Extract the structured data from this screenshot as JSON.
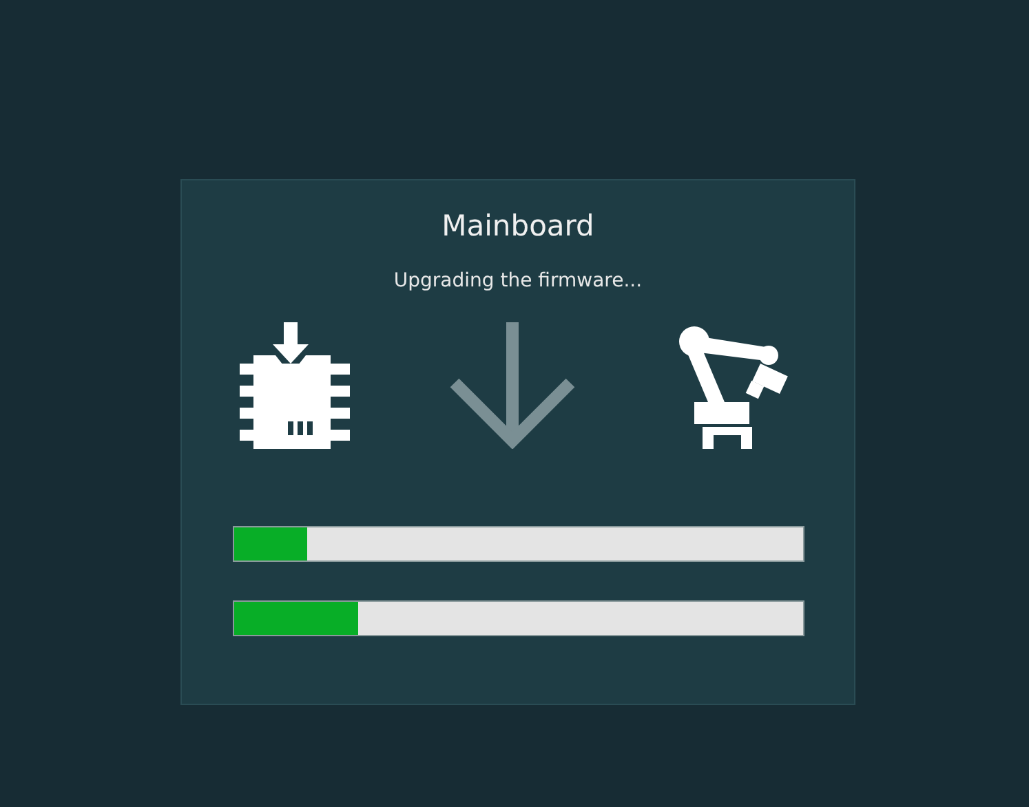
{
  "dialog": {
    "title": "Mainboard",
    "message": "Upgrading the firmware...",
    "progress": [
      {
        "level": 0.13
      },
      {
        "level": 0.22
      }
    ]
  }
}
